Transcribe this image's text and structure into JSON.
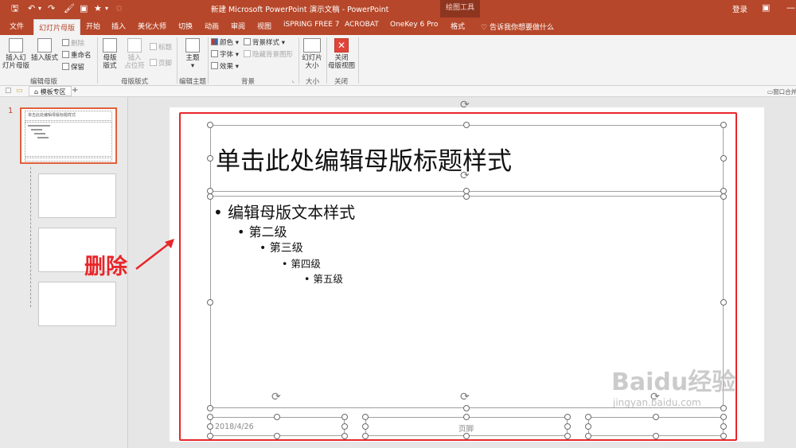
{
  "qat": {
    "save": "🖫",
    "undo": "↶",
    "undo_arrow": "▾",
    "redo": "↷",
    "format_painter": "🖌",
    "extra": "▣",
    "star": "★",
    "dropdown": "▾",
    "star2": "✩"
  },
  "window": {
    "title": "新建 Microsoft PowerPoint 演示文稿 - PowerPoint",
    "context_tab": "绘图工具",
    "login": "登录",
    "restore": "▣",
    "minimize": "—"
  },
  "tabs": [
    "文件",
    "幻灯片母版",
    "开始",
    "插入",
    "美化大师",
    "切换",
    "动画",
    "审阅",
    "视图",
    "iSPRING FREE 7",
    "ACROBAT",
    "OneKey 6 Pro",
    "格式"
  ],
  "tell_me": "告诉我你想要做什么",
  "ribbon": {
    "insert_master": [
      "插入幻",
      "灯片母版"
    ],
    "insert_layout": "插入版式",
    "delete": "删除",
    "rename": "重命名",
    "preserve": "保留",
    "group_edit_master": "编辑母版",
    "master_layout": [
      "母版",
      "版式"
    ],
    "insert_placeholder": [
      "插入",
      "占位符"
    ],
    "title_check": "标题",
    "footer_check": "页脚",
    "group_master_layout": "母版版式",
    "themes": "主题",
    "group_edit_theme": "编辑主题",
    "colors": "颜色",
    "fonts": "字体",
    "effects": "效果",
    "bg_styles": "背景样式",
    "hide_bg": "隐藏背景图形",
    "group_background": "背景",
    "slide_size": [
      "幻灯片",
      "大小"
    ],
    "group_size": "大小",
    "close_master": [
      "关闭",
      "母版视图"
    ],
    "group_close": "关闭"
  },
  "subbar": {
    "section": "模板专区",
    "plus": "+",
    "right": "窗口合并"
  },
  "slides_panel": {
    "slide_number": "1",
    "thumb_title": "单击此处编辑母版标题样式"
  },
  "slide": {
    "title": "单击此处编辑母版标题样式",
    "levels": [
      "编辑母版文本样式",
      "第二级",
      "第三级",
      "第四级",
      "第五级"
    ],
    "date": "2018/4/26",
    "footer": "页脚"
  },
  "annotation": {
    "text": "删除",
    "color": "#e8262a"
  },
  "watermark": {
    "brand": "Baidu经验",
    "url": "jingyan.baidu.com"
  },
  "colors": {
    "accent": "#b7472a",
    "highlight": "#e8262a"
  }
}
